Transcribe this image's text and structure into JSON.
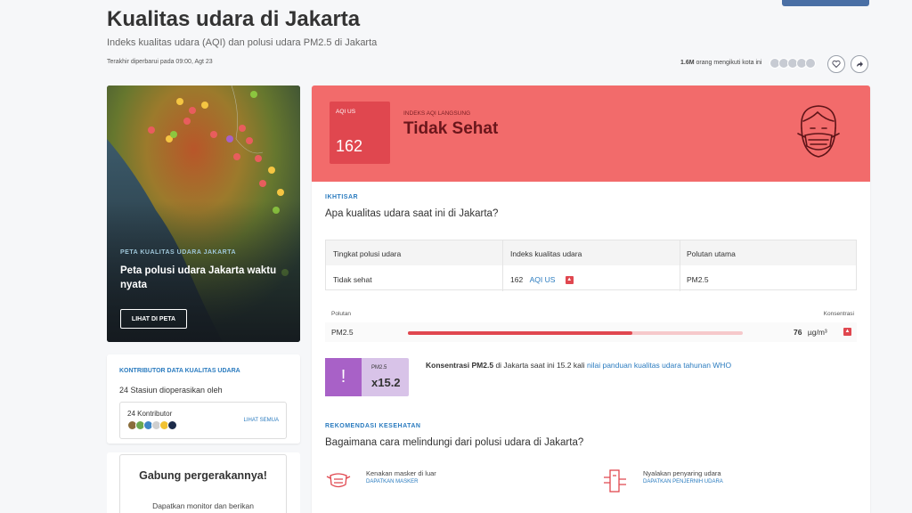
{
  "page": {
    "title": "Kualitas udara di Jakarta",
    "subtitle": "Indeks kualitas udara (AQI) dan polusi udara PM2.5 di Jakarta",
    "updated": "Terakhir diperbarui pada 09:00, Agt 23",
    "followers_count": "1.6M",
    "followers_text": "orang mengikuti kota ini",
    "favorite_icon": "heart-icon",
    "share_icon": "share-icon"
  },
  "map_card": {
    "caption": "PETA KUALITAS UDARA JAKARTA",
    "title": "Peta polusi udara Jakarta waktu nyata",
    "button": "LIHAT DI PETA"
  },
  "contributors": {
    "caption": "KONTRIBUTOR DATA KUALITAS UDARA",
    "stations": "24 Stasiun dioperasikan oleh",
    "count": "24 Kontributor",
    "see_all": "LIHAT SEMUA"
  },
  "join": {
    "title": "Gabung pergerakannya!",
    "desc": "Dapatkan monitor dan berikan"
  },
  "aqi": {
    "label": "AQI US",
    "value": "162",
    "live_caption": "INDEKS AQI LANGSUNG",
    "status": "Tidak Sehat",
    "colors": {
      "header": "#f26b6b",
      "box": "#e0474f"
    }
  },
  "overview": {
    "caption": "IKHTISAR",
    "question": "Apa kualitas udara saat ini di Jakarta?",
    "table": {
      "headers": [
        "Tingkat polusi udara",
        "Indeks kualitas udara",
        "Polutan utama"
      ],
      "level": "Tidak sehat",
      "aqi_value": "162",
      "aqi_unit": "AQI US",
      "pollutant": "PM2.5"
    }
  },
  "pollutant_row": {
    "col_pollutant": "Polutan",
    "col_concentration": "Konsentrasi",
    "name": "PM2.5",
    "level_fraction": 0.67,
    "value": "76",
    "unit": "µg/m³"
  },
  "who": {
    "badge_caption": "PM2.5",
    "badge_value": "x15.2",
    "badge_icon": "exclamation-icon",
    "text_bold": "Konsentrasi PM2.5",
    "text_mid": "di Jakarta saat ini 15.2 kali",
    "text_link": "nilai panduan kualitas udara tahunan WHO"
  },
  "recommendations": {
    "caption": "REKOMENDASI KESEHATAN",
    "question": "Bagaimana cara melindungi dari polusi udara di Jakarta?",
    "items": [
      {
        "icon": "mask-icon",
        "text": "Kenakan masker di luar",
        "link": "DAPATKAN MASKER"
      },
      {
        "icon": "air-purifier-icon",
        "text": "Nyalakan penyaring udara",
        "link": "DAPATKAN PENJERNIH UDARA"
      }
    ]
  }
}
